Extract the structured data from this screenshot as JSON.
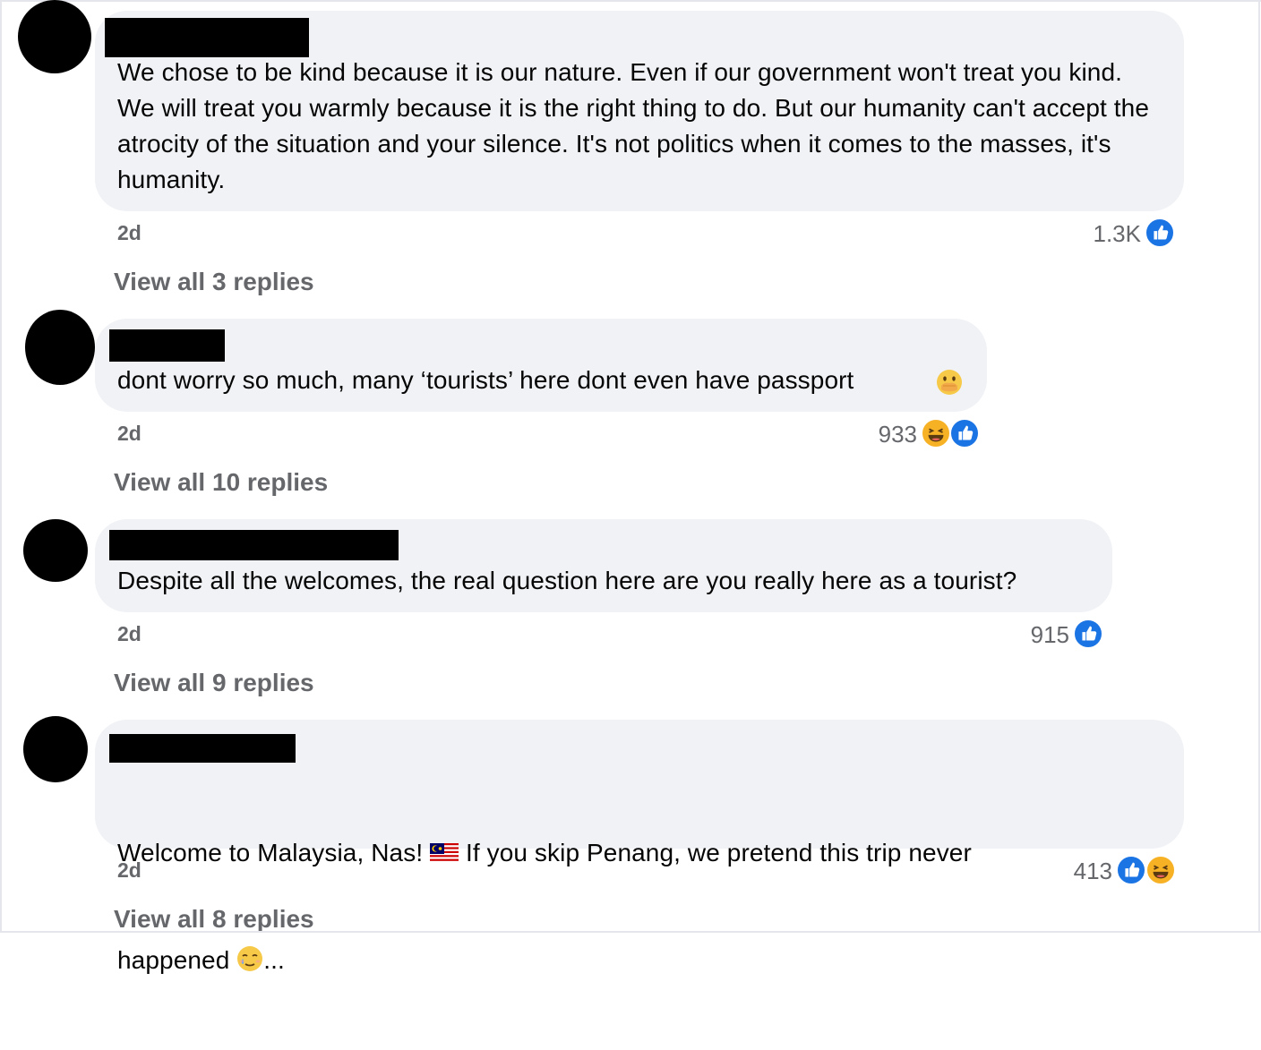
{
  "comments": [
    {
      "text": "We chose to be kind because it is our nature. Even if our government won't treat you kind. We will treat you warmly because it is the right thing to do. But our humanity can't accept the atrocity of the situation and your silence. It's not politics when it comes to the masses, it's humanity.",
      "time": "2d",
      "reactions": "1.3K",
      "reaction_icons": [
        "like-icon"
      ],
      "replies": "View all 3 replies"
    },
    {
      "text": "dont worry so much, many ‘tourists’ here dont even have passport ",
      "emoji": "hand-over-mouth-emoji",
      "time": "2d",
      "reactions": "933",
      "reaction_icons": [
        "haha-icon",
        "like-icon"
      ],
      "replies": "View all 10 replies"
    },
    {
      "text": "Despite all the welcomes, the real question here are you really here as a tourist?",
      "time": "2d",
      "reactions": "915",
      "reaction_icons": [
        "like-icon"
      ],
      "replies": "View all 9 replies"
    },
    {
      "text_line1": "Welcome to Malaysia, Nas! ",
      "flag": "malaysia-flag-icon",
      "text_line1b": " If you skip Penang, we pretend this trip never",
      "text_line2": "happened ",
      "emoji": "smiling-tear-emoji",
      "text_line2b": "...",
      "time": "2d",
      "reactions": "413",
      "reaction_icons": [
        "like-icon",
        "haha-icon"
      ],
      "replies": "View all 8 replies"
    }
  ],
  "colors": {
    "bubble": "#f0f2f5",
    "meta_text": "#65676b",
    "like_blue": "#1b74e4",
    "haha_yellow": "#f7b125"
  }
}
